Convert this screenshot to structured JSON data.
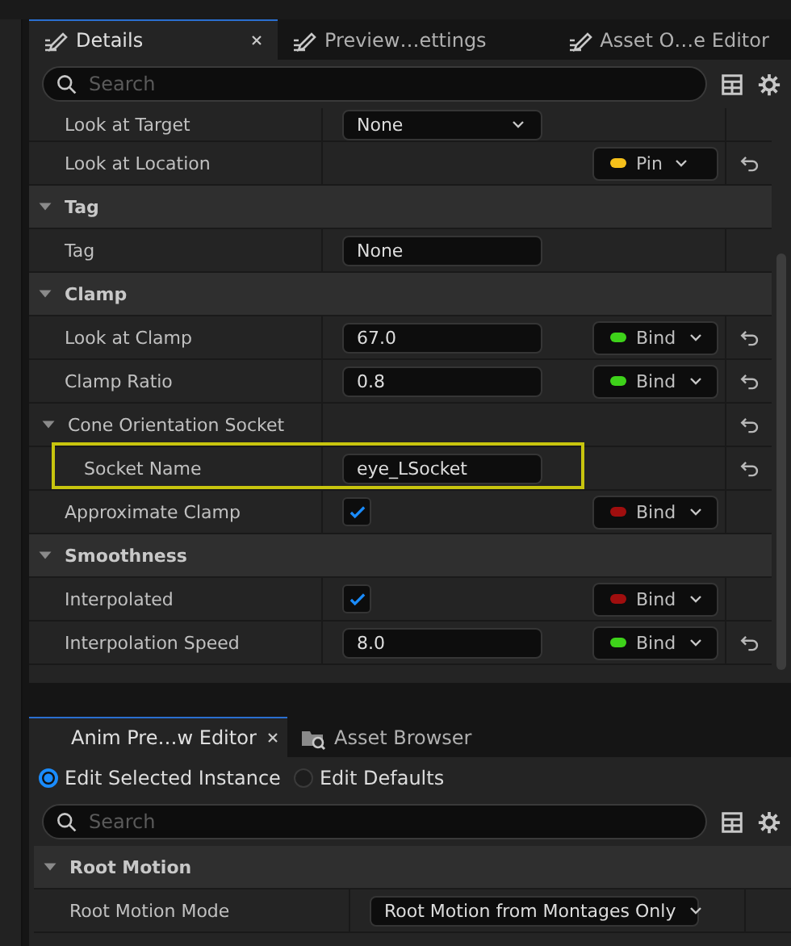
{
  "details_panel": {
    "tabs": [
      {
        "label": "Details",
        "selected": true,
        "closable": true
      },
      {
        "label": "Preview…ettings",
        "selected": false,
        "closable": false
      },
      {
        "label": "Asset O…e Editor",
        "selected": false,
        "closable": false
      }
    ],
    "search": {
      "placeholder": "Search"
    },
    "rows": [
      {
        "kind": "dropdown",
        "label": "Look at Target",
        "value": "None",
        "reset": false,
        "highlighted": false
      },
      {
        "kind": "plain",
        "label": "Look at Location",
        "pin": {
          "label": "Pin",
          "color": "#f5c01a"
        },
        "reset": true,
        "highlighted": false
      },
      {
        "kind": "category",
        "label": "Tag",
        "expanded": true
      },
      {
        "kind": "text",
        "label": "Tag",
        "value": "None",
        "reset": false,
        "highlighted": false
      },
      {
        "kind": "category",
        "label": "Clamp",
        "expanded": true
      },
      {
        "kind": "text",
        "label": "Look at Clamp",
        "value": "67.0",
        "pin": {
          "label": "Bind",
          "color": "#3ed21a"
        },
        "reset": true,
        "highlighted": false
      },
      {
        "kind": "text",
        "label": "Clamp Ratio",
        "value": "0.8",
        "pin": {
          "label": "Bind",
          "color": "#3ed21a"
        },
        "reset": true,
        "highlighted": false
      },
      {
        "kind": "group",
        "label": "Cone Orientation Socket",
        "expanded": true,
        "reset": true,
        "highlighted": false,
        "children": [
          {
            "kind": "text",
            "label": "Socket Name",
            "value": "eye_LSocket",
            "reset": true,
            "highlighted": true
          }
        ]
      },
      {
        "kind": "checkbox",
        "label": "Approximate Clamp",
        "checked": true,
        "pin": {
          "label": "Bind",
          "color": "#a00e0e"
        },
        "reset": false,
        "highlighted": false
      },
      {
        "kind": "category",
        "label": "Smoothness",
        "expanded": true
      },
      {
        "kind": "checkbox",
        "label": "Interpolated",
        "checked": true,
        "pin": {
          "label": "Bind",
          "color": "#a00e0e"
        },
        "reset": false,
        "highlighted": false
      },
      {
        "kind": "text",
        "label": "Interpolation Speed",
        "value": "8.0",
        "pin": {
          "label": "Bind",
          "color": "#3ed21a"
        },
        "reset": true,
        "highlighted": false
      }
    ]
  },
  "anim_panel": {
    "tabs": [
      {
        "label": "Anim Pre…w Editor",
        "selected": true,
        "closable": true
      },
      {
        "label": "Asset Browser",
        "selected": false,
        "closable": false
      }
    ],
    "options": [
      {
        "label": "Edit Selected Instance",
        "selected": true
      },
      {
        "label": "Edit Defaults",
        "selected": false
      }
    ],
    "search": {
      "placeholder": "Search"
    },
    "rows": [
      {
        "kind": "category",
        "label": "Root Motion",
        "expanded": true
      },
      {
        "kind": "dropdown",
        "label": "Root Motion Mode",
        "value": "Root Motion from Montages Only",
        "reset": false,
        "highlighted": false
      }
    ]
  }
}
